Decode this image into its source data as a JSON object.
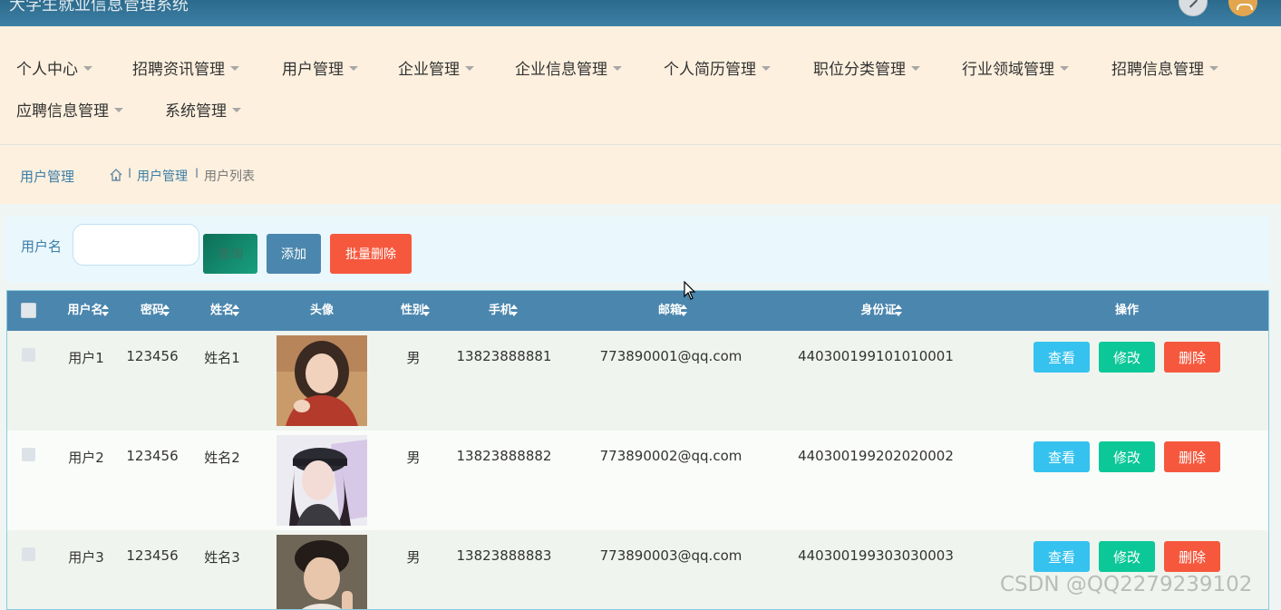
{
  "app": {
    "title": "大学生就业信息管理系统"
  },
  "nav": {
    "items": [
      {
        "label": "个人中心"
      },
      {
        "label": "招聘资讯管理"
      },
      {
        "label": "用户管理"
      },
      {
        "label": "企业管理"
      },
      {
        "label": "企业信息管理"
      },
      {
        "label": "个人简历管理"
      },
      {
        "label": "职位分类管理"
      },
      {
        "label": "行业领域管理"
      },
      {
        "label": "招聘信息管理"
      },
      {
        "label": "应聘信息管理"
      },
      {
        "label": "系统管理"
      }
    ]
  },
  "breadcrumb": {
    "title": "用户管理",
    "sep": "I",
    "level1": "用户管理",
    "level2": "用户列表"
  },
  "search": {
    "label": "用户名",
    "value": "",
    "placeholder": "",
    "query_label": "查询",
    "add_label": "添加",
    "batch_delete_label": "批量删除"
  },
  "table": {
    "headers": [
      "用户名",
      "密码",
      "姓名",
      "头像",
      "性别",
      "手机",
      "邮箱",
      "身份证",
      "操作"
    ],
    "rows": [
      {
        "username": "用户1",
        "password": "123456",
        "name": "姓名1",
        "gender": "男",
        "phone": "13823888881",
        "email": "773890001@qq.com",
        "idcard": "440300199101010001"
      },
      {
        "username": "用户2",
        "password": "123456",
        "name": "姓名2",
        "gender": "男",
        "phone": "13823888882",
        "email": "773890002@qq.com",
        "idcard": "440300199202020002"
      },
      {
        "username": "用户3",
        "password": "123456",
        "name": "姓名3",
        "gender": "男",
        "phone": "13823888883",
        "email": "773890003@qq.com",
        "idcard": "440300199303030003"
      }
    ],
    "actions": {
      "view": "查看",
      "edit": "修改",
      "delete": "删除"
    }
  },
  "watermark": "CSDN @QQ2279239102",
  "colors": {
    "header_blue": "#4a86ad",
    "nav_bg": "#fdf0df",
    "btn_view": "#35c2ef",
    "btn_edit": "#0cc797",
    "btn_delete": "#f5583d"
  }
}
